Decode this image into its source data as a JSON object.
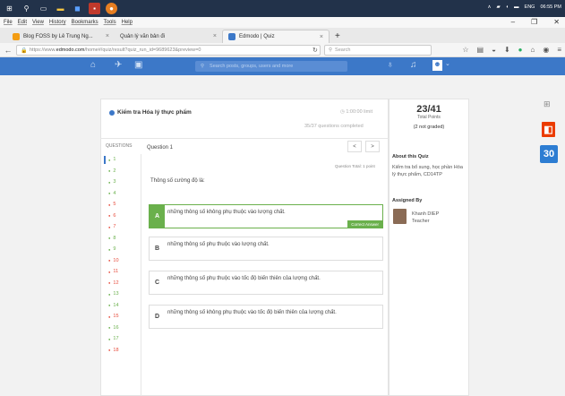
{
  "menu": [
    "File",
    "Edit",
    "View",
    "History",
    "Bookmarks",
    "Tools",
    "Help"
  ],
  "tray": {
    "lang": "ENG",
    "time": "06:55 PM"
  },
  "tabs": [
    {
      "label": "Blog FOSS by Lê Trung Ng...",
      "active": false
    },
    {
      "label": "Quản lý văn bản đi",
      "active": false
    },
    {
      "label": "Edmodo | Quiz",
      "active": true
    }
  ],
  "address": {
    "prefix": "https://www.",
    "domain": "edmodo.com",
    "path": "/home#/quiz/result?quiz_run_id=9689623&preview=0"
  },
  "search_placeholder": "Search",
  "app_search_placeholder": "Search posts, groups, users and more",
  "quiz": {
    "title": "Kiểm tra Hóa lý thực phẩm",
    "time_limit": "1:00:00 limit",
    "completed": "35/37 questions completed",
    "questions_header": "QUESTIONS",
    "current_question": "Question 1",
    "question_total": "Question Total: 1 point",
    "question_text": "Thông số cường độ là:",
    "correct_label": "Correct Answer",
    "answers": [
      {
        "letter": "A",
        "text": "những thông số không phụ thuộc vào lượng chất.",
        "correct": true
      },
      {
        "letter": "B",
        "text": "những thông số phụ thuộc vào lượng chất.",
        "correct": false
      },
      {
        "letter": "C",
        "text": "những thông số phụ thuộc vào tốc độ biến thiên của lượng chất.",
        "correct": false
      },
      {
        "letter": "D",
        "text": "những thông số không phụ thuộc vào tốc độ biến thiên của lượng chất.",
        "correct": false
      }
    ],
    "question_numbers": [
      {
        "n": "1",
        "status": "correct"
      },
      {
        "n": "2",
        "status": "correct"
      },
      {
        "n": "3",
        "status": "correct"
      },
      {
        "n": "4",
        "status": "correct"
      },
      {
        "n": "5",
        "status": "wrong"
      },
      {
        "n": "6",
        "status": "wrong"
      },
      {
        "n": "7",
        "status": "wrong"
      },
      {
        "n": "8",
        "status": "correct"
      },
      {
        "n": "9",
        "status": "correct"
      },
      {
        "n": "10",
        "status": "wrong"
      },
      {
        "n": "11",
        "status": "wrong"
      },
      {
        "n": "12",
        "status": "wrong"
      },
      {
        "n": "13",
        "status": "correct"
      },
      {
        "n": "14",
        "status": "correct"
      },
      {
        "n": "15",
        "status": "wrong"
      },
      {
        "n": "16",
        "status": "correct"
      },
      {
        "n": "17",
        "status": "correct"
      },
      {
        "n": "18",
        "status": "wrong"
      }
    ]
  },
  "sidebar": {
    "score": "23/41",
    "score_label": "Total Points",
    "graded": "(2 not graded)",
    "about_heading": "About this Quiz",
    "about_text": "Kiểm tra bổ sung, học phần Hóa lý thực phẩm, CD14TP",
    "assigned_heading": "Assigned By",
    "teacher_name": "Khanh DIEP",
    "teacher_role": "Teacher"
  },
  "calendar_day": "30",
  "colors": {
    "correct": "#6ab04c",
    "wrong": "#e74c3c",
    "nav": "#3c78c8"
  }
}
